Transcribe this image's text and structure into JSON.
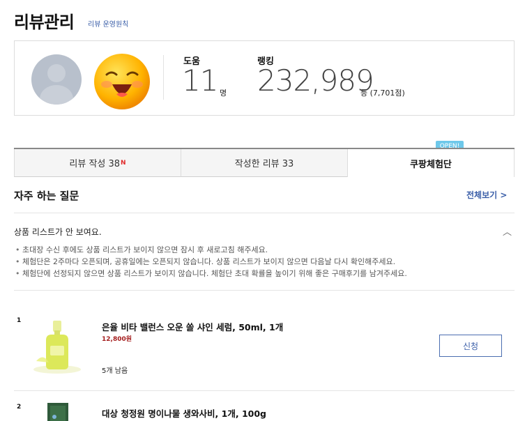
{
  "header": {
    "title": "리뷰관리",
    "policy_link": "리뷰 운영원칙"
  },
  "profile": {
    "help_label": "도움",
    "help_value": "11",
    "help_unit": "명",
    "rank_label": "랭킹",
    "rank_value": "232,989",
    "rank_unit": "등 (7,701점)"
  },
  "tabs": [
    {
      "label": "리뷰 작성 38",
      "badge": "N"
    },
    {
      "label": "작성한 리뷰 33"
    },
    {
      "label": "쿠팡체험단"
    }
  ],
  "open_badge": "OPEN!",
  "faq": {
    "title": "자주 하는 질문",
    "more": "전체보기 >",
    "question": "상품 리스트가 안 보여요.",
    "answers": [
      "초대장 수신 후에도 상품 리스트가 보이지 않으면 잠시 후 새로고침 해주세요.",
      "체험단은 2주마다 오픈되며, 공휴일에는 오픈되지 않습니다. 상품 리스트가 보이지 않으면 다음날 다시 확인해주세요.",
      "체험단에 선정되지 않으면 상품 리스트가 보이지 않습니다. 체험단 초대 확률을 높이기 위해 좋은 구매후기를 남겨주세요."
    ]
  },
  "products": [
    {
      "rank": "1",
      "name": "은율 비타 밸런스 오운 쏠 샤인 세럼, 50ml, 1개",
      "price": "12,800원",
      "left": "5개 남음",
      "button": "신청"
    },
    {
      "rank": "2",
      "name": "대상 청정원 명이나물 생와사비, 1개, 100g"
    }
  ],
  "colors": {
    "accent": "#3a5ea8",
    "price": "#a41d1d",
    "open_badge": "#6ec8ea",
    "new_badge": "#e02a2a"
  }
}
